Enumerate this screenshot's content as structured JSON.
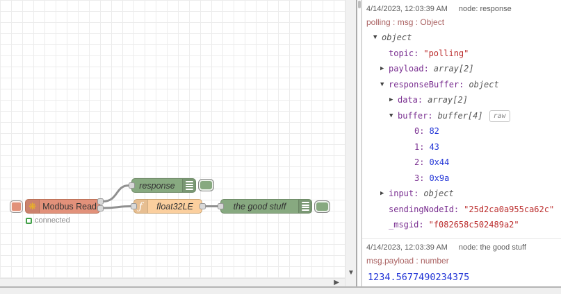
{
  "canvas": {
    "nodes": {
      "modbus_read": {
        "label": "Modbus Read",
        "status": "connected",
        "color": "#e2917a"
      },
      "response": {
        "label": "response",
        "color": "#87a980"
      },
      "float32le": {
        "label": "float32LE",
        "icon_glyph": "ƒ",
        "color": "#fbcf9e"
      },
      "good_stuff": {
        "label": "the good stuff",
        "color": "#87a980"
      }
    }
  },
  "sidebar": {
    "messages": [
      {
        "timestamp": "4/14/2023, 12:03:39 AM",
        "source": "node: response",
        "path": "polling : msg : Object",
        "tree": [
          {
            "key": "",
            "value": "object",
            "type": "meta",
            "expanded": true
          },
          {
            "key": "topic:",
            "value": "\"polling\"",
            "type": "string"
          },
          {
            "key": "payload:",
            "value": "array[2]",
            "type": "meta",
            "expanded": false
          },
          {
            "key": "responseBuffer:",
            "value": "object",
            "type": "meta",
            "expanded": true
          },
          {
            "key": "data:",
            "value": "array[2]",
            "type": "meta",
            "expanded": false
          },
          {
            "key": "buffer:",
            "value": "buffer[4]",
            "type": "meta",
            "expanded": true,
            "badge": "raw"
          },
          {
            "key": "0:",
            "value": "82",
            "type": "number"
          },
          {
            "key": "1:",
            "value": "43",
            "type": "number"
          },
          {
            "key": "2:",
            "value": "0x44",
            "type": "number"
          },
          {
            "key": "3:",
            "value": "0x9a",
            "type": "number"
          },
          {
            "key": "input:",
            "value": "object",
            "type": "meta",
            "expanded": false
          },
          {
            "key": "sendingNodeId:",
            "value": "\"25d2ca0a955ca62c\"",
            "type": "string"
          },
          {
            "key": "_msgid:",
            "value": "\"f082658c502489a2\"",
            "type": "string"
          }
        ]
      },
      {
        "timestamp": "4/14/2023, 12:03:39 AM",
        "source": "node: the good stuff",
        "path": "msg.payload : number",
        "value": "1234.5677490234375"
      }
    ]
  },
  "colors": {
    "node_modbus": "#e2917a",
    "node_debug": "#87a980",
    "node_function": "#fbcf9e",
    "wire": "#909090",
    "tree_key": "#792e90",
    "tree_string": "#bb2c2c",
    "tree_number": "#2033d6",
    "tree_meta": "#555555",
    "message_path": "#aa6262",
    "status_ok": "#42a048",
    "modbus_icon_gold": "#ecb71f"
  }
}
